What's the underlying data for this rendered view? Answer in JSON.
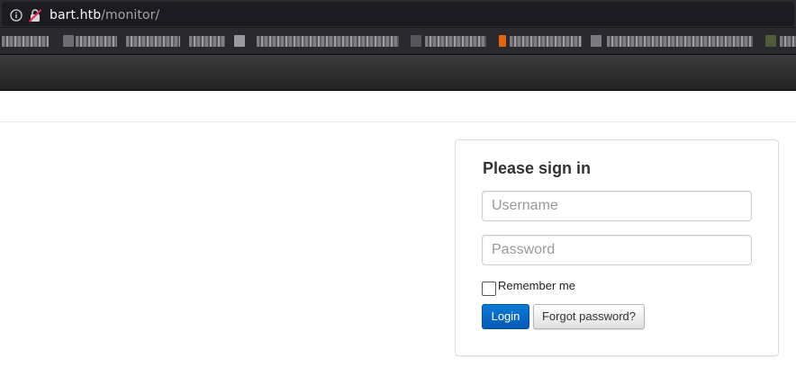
{
  "browser": {
    "url_host": "bart.htb",
    "url_path": "/monitor/"
  },
  "login": {
    "heading": "Please sign in",
    "username_placeholder": "Username",
    "password_placeholder": "Password",
    "remember_label": "Remember me",
    "login_button": "Login",
    "forgot_button": "Forgot password?"
  },
  "colors": {
    "navbar": "#222222",
    "login_button": "#0d6bc9",
    "url_bar": "#2a2a2e"
  }
}
